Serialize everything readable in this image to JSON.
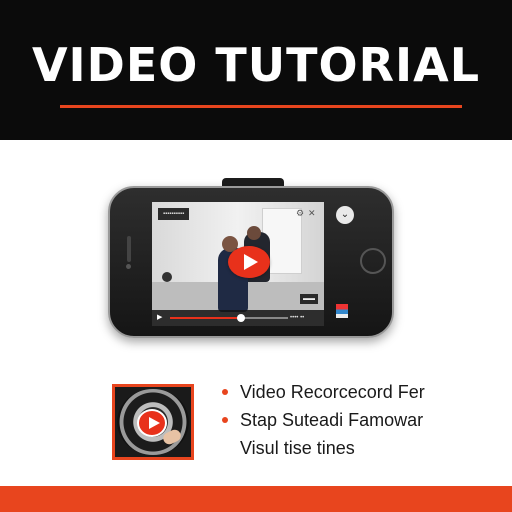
{
  "header": {
    "title": "VIDEO TUTORIAL"
  },
  "colors": {
    "accent": "#e8451e",
    "play_red": "#e8311b",
    "banner": "#0b0b0b"
  },
  "video": {
    "progress": 0.6,
    "icons": [
      "play-icon",
      "close-icon",
      "settings-icon"
    ]
  },
  "feature_list": {
    "items": [
      "Video Recorcecord Fer",
      "Stap Suteadi Famowar"
    ],
    "continuation": "Visul tise tines"
  }
}
